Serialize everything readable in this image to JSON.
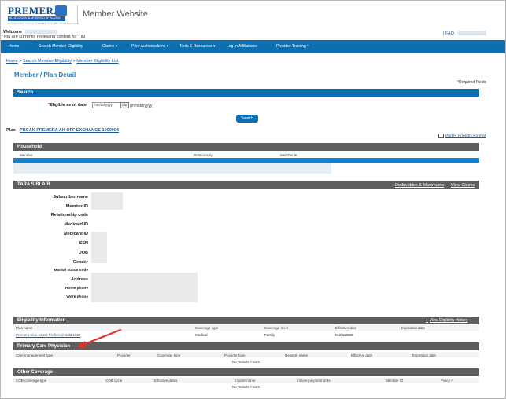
{
  "logo": {
    "brand": "PREMERA",
    "sub": "BLUE CROSS BLUE SHIELD OF ALASKA",
    "tagline": "An Independent Licensee of the Blue Cross Blue Shield Association"
  },
  "site_title": "Member Website",
  "welcome": {
    "label": "Welcome",
    "line2": "You are currently reviewing content for TIN",
    "faq": "| FAQ |"
  },
  "nav": {
    "items": [
      "Home",
      "Search Member Eligibility",
      "Claims ▾",
      "Prior Authorizations ▾",
      "Tools & Resources ▾",
      "Log-in Affiliations",
      "Provider Training ▾"
    ]
  },
  "breadcrumb": {
    "home": "Home",
    "sep1": ">",
    "search": "Search Member Eligibility",
    "sep2": ">",
    "list": "Member Eligibility List"
  },
  "page_title": "Member / Plan Detail",
  "required_note": {
    "star": "*",
    "text": "Required Fields"
  },
  "search": {
    "title": "Search",
    "label_star": "*",
    "label": "Eligible as of date",
    "date_value": "mm/dd/yyyy",
    "cal_label": "CAL",
    "format_hint": "(mm/dd/yyyy)",
    "button": "Search"
  },
  "plan": {
    "label": "Plan",
    "value": "PBCAK PREMERA AK OFF EXCHANGE 1000004"
  },
  "printer_link": "Printer Friendly Format",
  "household": {
    "title": "Household",
    "columns": [
      "Member",
      "Relationship",
      "Member ID"
    ]
  },
  "member": {
    "name": "TARA  S BLAIR",
    "link_deductibles": "Deductibles & Maximums",
    "link_claims": "View Claims",
    "fields": [
      "Subscriber name",
      "Member ID",
      "Relationship code",
      "Medicaid ID",
      "Medicare ID",
      "SSN",
      "DOB",
      "Gender",
      "Marital status code",
      "Address",
      "Home phone",
      "Work phone"
    ]
  },
  "eligibility": {
    "title": "Eligibility Information",
    "history_link": "View Eligibility History",
    "columns": [
      "Plan name",
      "Coverage type",
      "Coverage level",
      "Effective date",
      "Expiration date"
    ],
    "rows": [
      {
        "plan": "Premera Blue Cross Preferred Gold 1500",
        "coverage_type": "Medical",
        "coverage_level": "Family",
        "effective": "01/01/2020",
        "expiration": ""
      }
    ]
  },
  "pcp": {
    "title": "Primary Care Physician",
    "columns": [
      "Care management type",
      "Provider",
      "Coverage type",
      "Provider type",
      "Network name",
      "Effective date",
      "Expiration date"
    ],
    "no_results": "No Results Found"
  },
  "other_coverage": {
    "title": "Other Coverage",
    "columns": [
      "COB coverage type",
      "COB cycle",
      "Effective dates",
      "Insurer name",
      "Insurer payment order",
      "Member ID",
      "Policy #"
    ],
    "no_results": "No Results Found"
  },
  "colors": {
    "nav_blue": "#0d6fb0",
    "section_dark": "#5e5e5e",
    "link_blue": "#1a5a9a",
    "annotation_red": "#e0322b"
  }
}
